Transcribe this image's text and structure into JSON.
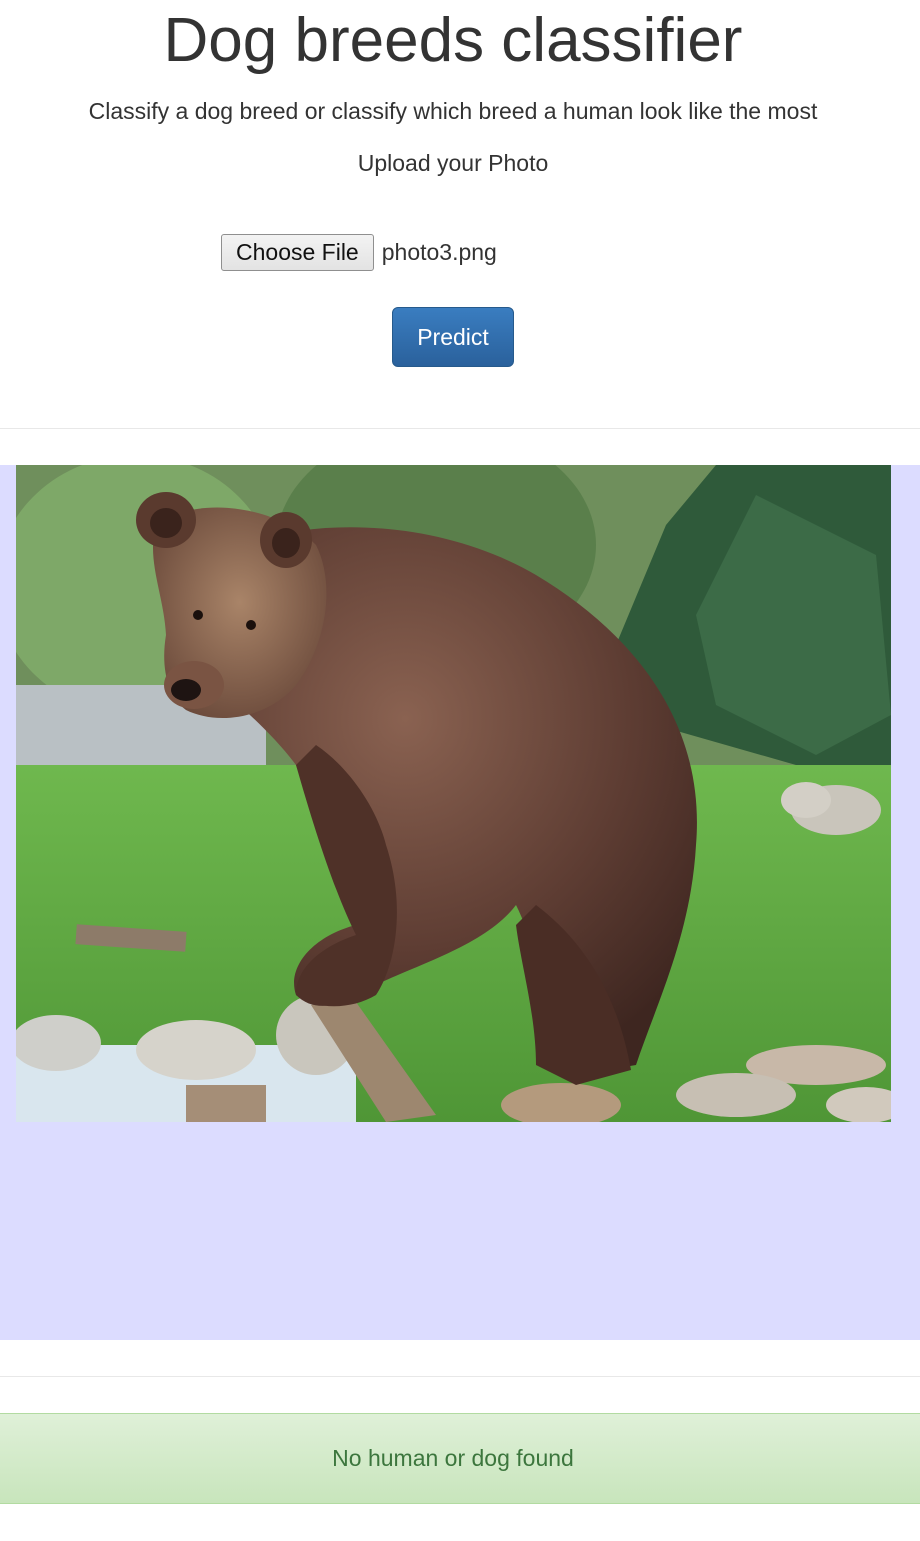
{
  "header": {
    "title": "Dog breeds classifier",
    "subtitle": "Classify a dog breed or classify which breed a human look like the most",
    "upload_label": "Upload your Photo"
  },
  "upload": {
    "choose_file_label": "Choose File",
    "file_name": "photo3.png"
  },
  "predict": {
    "label": "Predict"
  },
  "result": {
    "image_subject": "brown-bear-photo",
    "panel_color": "#dcdcff",
    "message": "No human or dog found",
    "message_color": "#3c763d"
  },
  "colors": {
    "primary": "#337ab7",
    "success_bg": "#dff0d8"
  }
}
